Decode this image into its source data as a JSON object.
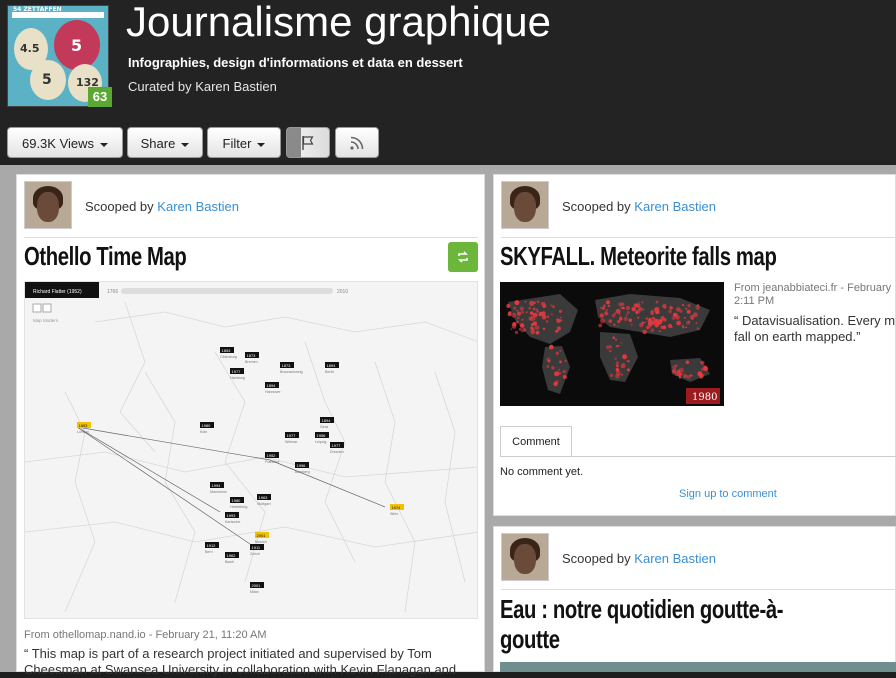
{
  "header": {
    "title": "Journalisme graphique",
    "subtitle": "Infographies, design d'informations et data en dessert",
    "curated_by": "Curated by Karen Bastien",
    "badge": "63",
    "thumb": {
      "banner": "54 ZETTAFFEN",
      "n1": "4.5",
      "n2": "5",
      "n3": "5",
      "n4": "132"
    }
  },
  "toolbar": {
    "views_label": "69.3K Views",
    "share_label": "Share",
    "filter_label": "Filter"
  },
  "posts": [
    {
      "scooped_prefix": "Scooped by",
      "author": "Karen Bastien",
      "title": "Othello Time Map",
      "source": "From othellomap.nand.io - February 21, 11:20 AM",
      "quote": "“ This map is part of a research project initiated and supervised by Tom Cheesman at Swansea University in collaboration with Kevin Flanagan and",
      "map": {
        "selector": "Richard Flatter (1952)",
        "year_start": "1766",
        "year_end": "2010",
        "map_mode": "Map Modern",
        "cities": [
          "London",
          "Bremen",
          "Hamburg",
          "Berlin",
          "Hannover",
          "Leipzig",
          "Dresden",
          "Frankfurt",
          "Bamberg",
          "Munich",
          "Zurich",
          "Wien",
          "Stuttgart",
          "Karlsruhe",
          "Mannheim",
          "Heidelberg",
          "Bern",
          "Basel",
          "Milan",
          "Köln",
          "Oldenburg",
          "Braunschweig",
          "Weimar",
          "Gera"
        ],
        "tags": [
          "1853",
          "1873",
          "1977",
          "1894",
          "1894",
          "1956",
          "1977",
          "1952",
          "1996",
          "2001",
          "1911",
          "1974",
          "1963",
          "1993",
          "1994",
          "1980",
          "1912",
          "1962",
          "2001",
          "1980"
        ]
      }
    },
    {
      "scooped_prefix": "Scooped by",
      "author": "Karen Bastien",
      "title": "SKYFALL. Meteorite falls map",
      "source_line1": "From jeanabbiateci.fr - February",
      "source_line2": "2:11 PM",
      "quote": "“ Datavisualisation. Every m fall on earth mapped.”",
      "image_year": "1980",
      "comment_tab": "Comment",
      "no_comment": "No comment yet.",
      "signup": "Sign up to comment"
    },
    {
      "scooped_prefix": "Scooped by",
      "author": "Karen Bastien",
      "title_line1": "Eau : notre quotidien goutte-à-",
      "title_line2": "goutte"
    }
  ],
  "colors": {
    "link": "#3b8fd0",
    "rescoop_green": "#6bb63b",
    "badge_green": "#5aa832",
    "header_bg": "#232323",
    "main_bg": "#a9a9a9"
  }
}
